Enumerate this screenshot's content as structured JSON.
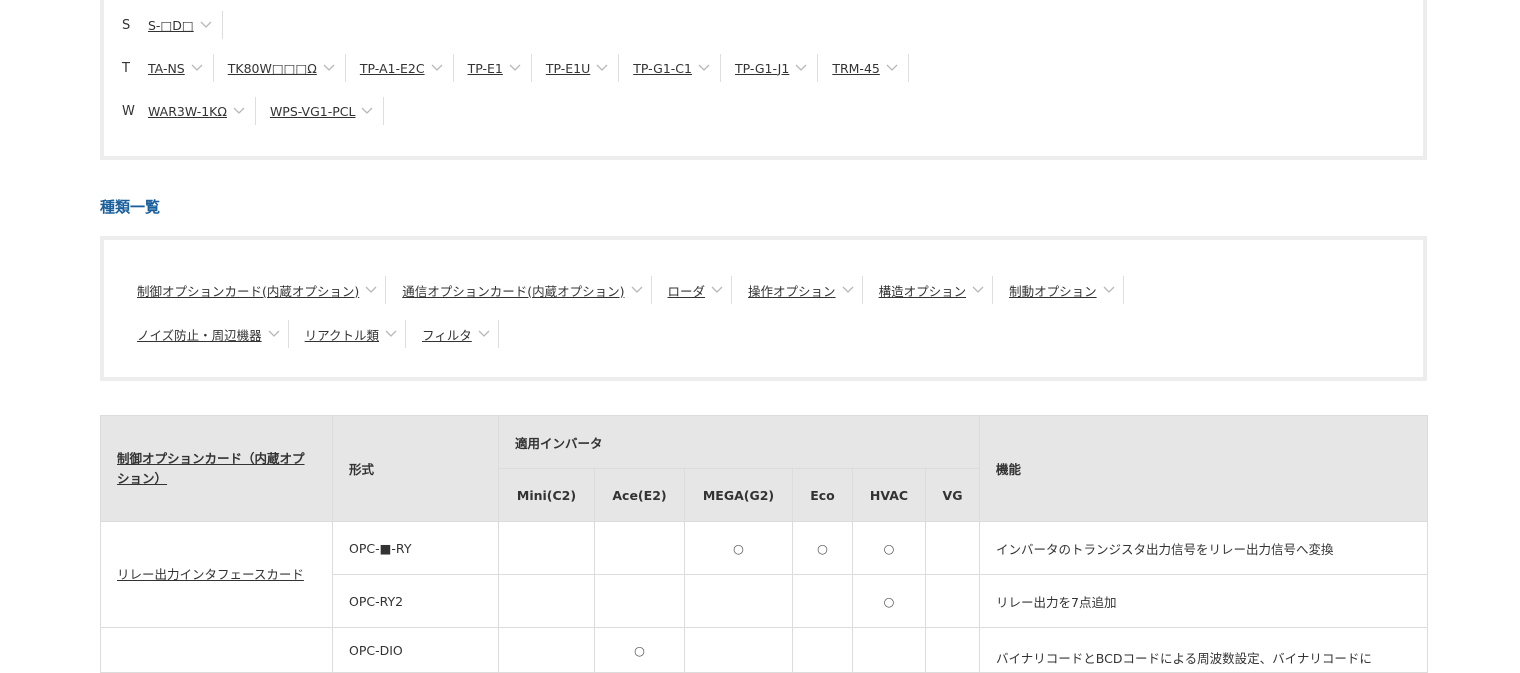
{
  "index": {
    "rows": [
      {
        "letter": "S",
        "items": [
          "S-□D□"
        ]
      },
      {
        "letter": "T",
        "items": [
          "TA-NS",
          "TK80W□□□Ω",
          "TP-A1-E2C",
          "TP-E1",
          "TP-E1U",
          "TP-G1-C1",
          "TP-G1-J1",
          "TRM-45"
        ]
      },
      {
        "letter": "W",
        "items": [
          "WAR3W-1KΩ",
          "WPS-VG1-PCL"
        ]
      }
    ]
  },
  "types": {
    "title": "種類一覧",
    "row1": [
      "制御オプションカード(内蔵オプション)",
      "通信オプションカード(内蔵オプション)",
      "ローダ",
      "操作オプション",
      "構造オプション",
      "制動オプション"
    ],
    "row2": [
      "ノイズ防止・周辺機器",
      "リアクトル類",
      "フィルタ"
    ]
  },
  "table": {
    "category_header": "制御オプションカード（内蔵オプション）",
    "model_header": "形式",
    "inverter_header": "適用インバータ",
    "inverters": [
      "Mini(C2)",
      "Ace(E2)",
      "MEGA(G2)",
      "Eco",
      "HVAC",
      "VG"
    ],
    "function_header": "機能",
    "mark": "○",
    "rows": [
      {
        "category": "リレー出力インタフェースカード",
        "entries": [
          {
            "model": "OPC-■-RY",
            "marks": [
              false,
              false,
              true,
              true,
              true,
              false
            ],
            "function": "インバータのトランジスタ出力信号をリレー出力信号へ変換"
          },
          {
            "model": "OPC-RY2",
            "marks": [
              false,
              false,
              false,
              false,
              true,
              false
            ],
            "function": "リレー出力を7点追加"
          }
        ]
      },
      {
        "category": "",
        "entries": [
          {
            "model": "OPC-DIO",
            "marks": [
              false,
              true,
              false,
              false,
              false,
              false
            ],
            "function": "バイナリコードとBCDコードによる周波数設定、バイナリコードに"
          }
        ]
      }
    ]
  }
}
